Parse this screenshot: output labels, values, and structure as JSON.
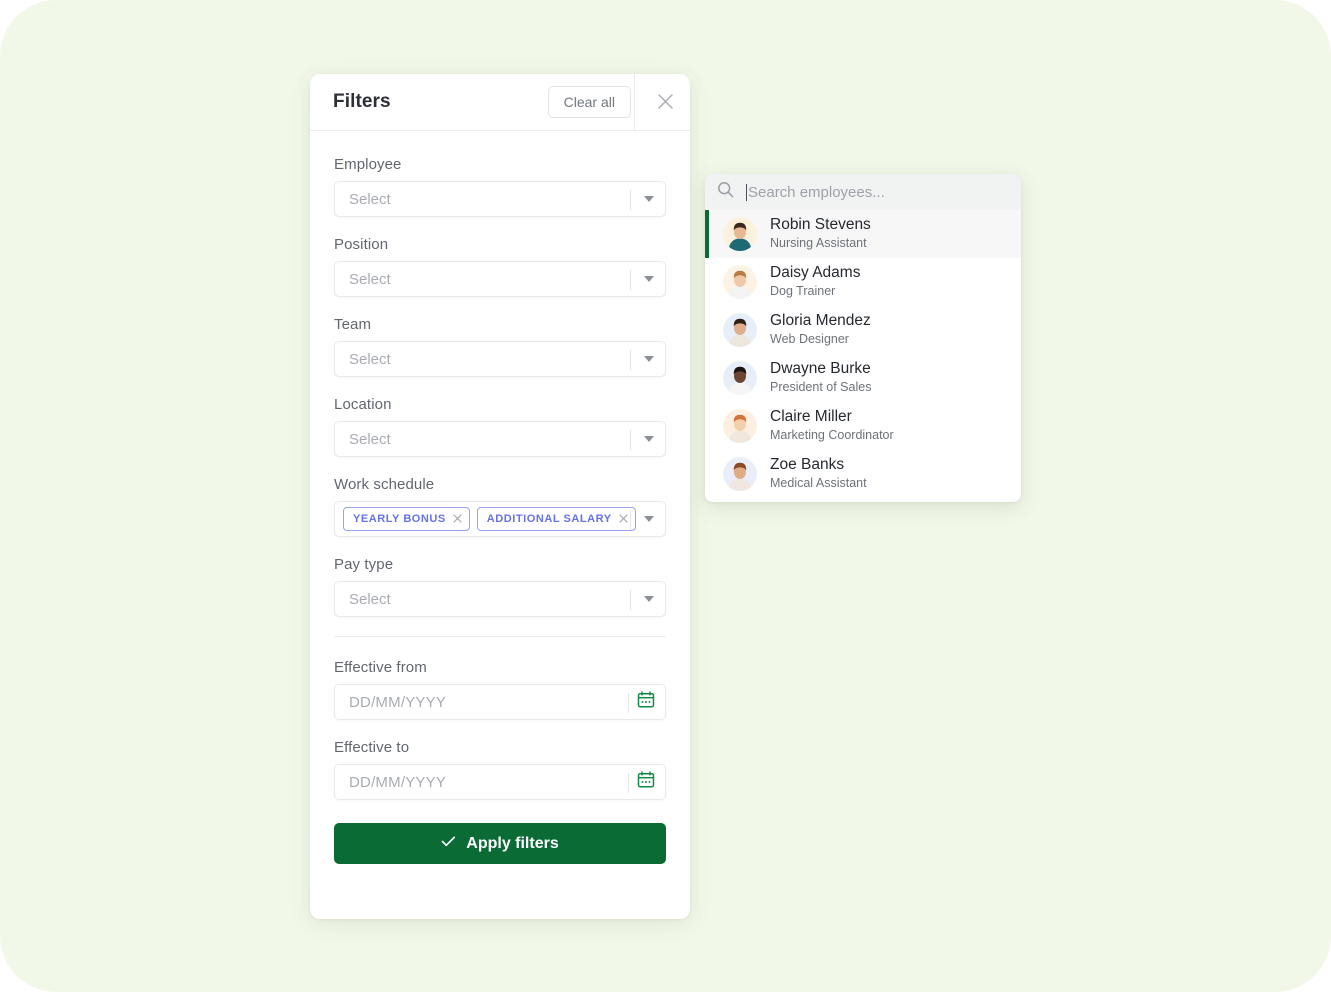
{
  "theme": {
    "background": "#f2f8e8",
    "primary_green": "#0a6b35",
    "tag_indigo": "#6672e8",
    "panel_white": "#ffffff"
  },
  "filter_panel": {
    "title": "Filters",
    "clear_all_label": "Clear all",
    "close_icon": "close-icon",
    "fields": [
      {
        "label": "Employee",
        "placeholder": "Select",
        "type": "select"
      },
      {
        "label": "Position",
        "placeholder": "Select",
        "type": "select"
      },
      {
        "label": "Team",
        "placeholder": "Select",
        "type": "select"
      },
      {
        "label": "Location",
        "placeholder": "Select",
        "type": "select"
      },
      {
        "label": "Work schedule",
        "type": "tags",
        "tags": [
          {
            "label": "YEARLY BONUS",
            "remove_icon": "close-icon"
          },
          {
            "label": "ADDITIONAL SALARY",
            "remove_icon": "close-icon"
          }
        ]
      },
      {
        "label": "Pay type",
        "placeholder": "Select",
        "type": "select"
      }
    ],
    "date_fields": [
      {
        "label": "Effective from",
        "placeholder": "DD/MM/YYYY",
        "value": "",
        "icon": "calendar-icon"
      },
      {
        "label": "Effective to",
        "placeholder": "DD/MM/YYYY",
        "value": "",
        "icon": "calendar-icon"
      }
    ],
    "apply_button": {
      "label": "Apply filters",
      "icon": "check-icon"
    }
  },
  "employee_dropdown": {
    "search": {
      "placeholder": "Search employees...",
      "value": "",
      "icon": "search-icon"
    },
    "employees": [
      {
        "name": "Robin Stevens",
        "role": "Nursing Assistant",
        "selected": true,
        "avatar_bg": "#fbf1dd",
        "skin": "#e8b894",
        "hair": "#3a2a1e",
        "shirt": "#1d6a74"
      },
      {
        "name": "Daisy Adams",
        "role": "Dog Trainer",
        "selected": false,
        "avatar_bg": "#fdf3e4",
        "skin": "#f0c9a8",
        "hair": "#b87b45",
        "shirt": "#f4f4f4"
      },
      {
        "name": "Gloria Mendez",
        "role": "Web Designer",
        "selected": false,
        "avatar_bg": "#e6eef8",
        "skin": "#dfae8c",
        "hair": "#2b2118",
        "shirt": "#ece6dd"
      },
      {
        "name": "Dwayne Burke",
        "role": "President of Sales",
        "selected": false,
        "avatar_bg": "#e8eef8",
        "skin": "#6b4733",
        "hair": "#1c1410",
        "shirt": "#f6f6f6"
      },
      {
        "name": "Claire Miller",
        "role": "Marketing Coordinator",
        "selected": false,
        "avatar_bg": "#fdf0e2",
        "skin": "#f3cfae",
        "hair": "#d4743a",
        "shirt": "#f2e7dd"
      },
      {
        "name": "Zoe Banks",
        "role": "Medical Assistant",
        "selected": false,
        "avatar_bg": "#e9eef8",
        "skin": "#e0ab85",
        "hair": "#8e4a26",
        "shirt": "#efe7e0"
      }
    ]
  }
}
